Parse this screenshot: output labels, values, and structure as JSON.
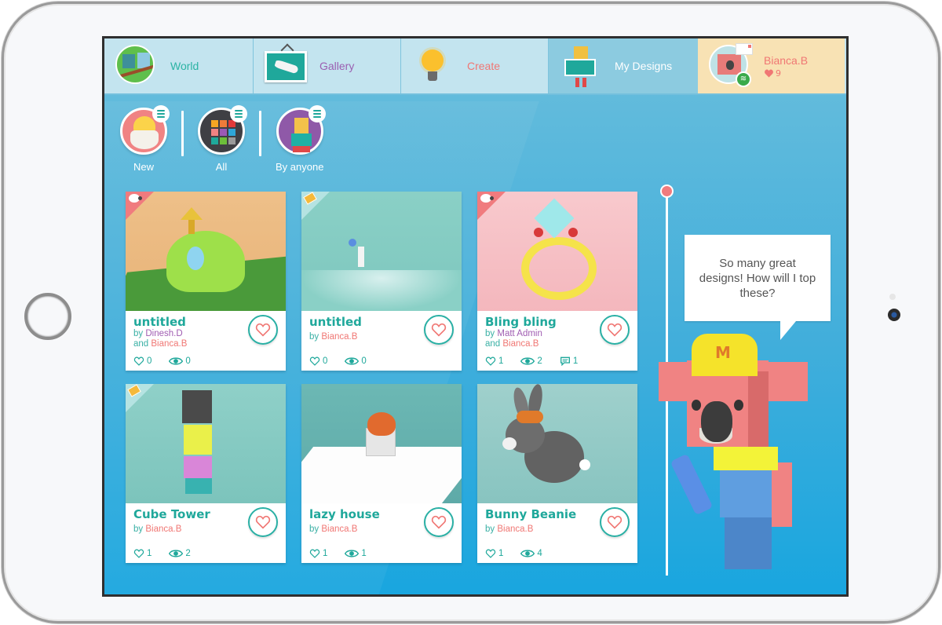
{
  "nav": {
    "tabs": [
      {
        "id": "world",
        "label": "World",
        "icon": "world-icon"
      },
      {
        "id": "gallery",
        "label": "Gallery",
        "icon": "gallery-icon"
      },
      {
        "id": "create",
        "label": "Create",
        "icon": "lightbulb-icon"
      },
      {
        "id": "my_designs",
        "label": "My Designs",
        "icon": "my-designs-icon",
        "active": true
      }
    ],
    "profile": {
      "username": "Bianca.B",
      "likes": "9"
    }
  },
  "filters": [
    {
      "label": "New",
      "icon": "chick-icon"
    },
    {
      "label": "All",
      "icon": "grid-icon"
    },
    {
      "label": "By anyone",
      "icon": "people-icon"
    }
  ],
  "cards": [
    {
      "title": "untitled",
      "by_prefix": "by",
      "author": "Dinesh.D",
      "and_prefix": "and",
      "coauthor": "Bianca.B",
      "likes": "0",
      "views": "0",
      "badge": "sheep"
    },
    {
      "title": "untitled",
      "by_prefix": "by",
      "author": "Bianca.B",
      "likes": "0",
      "views": "0",
      "badge": "map"
    },
    {
      "title": "Bling bling",
      "by_prefix": "by",
      "author": "Matt Admin",
      "and_prefix": "and",
      "coauthor": "Bianca.B",
      "likes": "1",
      "views": "2",
      "comments": "1",
      "badge": "sheep"
    },
    {
      "title": "Cube Tower",
      "by_prefix": "by",
      "author": "Bianca.B",
      "likes": "1",
      "views": "2",
      "badge": "map"
    },
    {
      "title": "lazy house",
      "by_prefix": "by",
      "author": "Bianca.B",
      "likes": "1",
      "views": "1"
    },
    {
      "title": "Bunny Beanie",
      "by_prefix": "by",
      "author": "Bianca.B",
      "likes": "1",
      "views": "4"
    }
  ],
  "mascot": {
    "speech": "So many great designs! How will I top these?",
    "hat_letter": "M"
  },
  "colors": {
    "accent": "#1fa89b",
    "heart": "#f07774",
    "background": "#41aedb"
  }
}
